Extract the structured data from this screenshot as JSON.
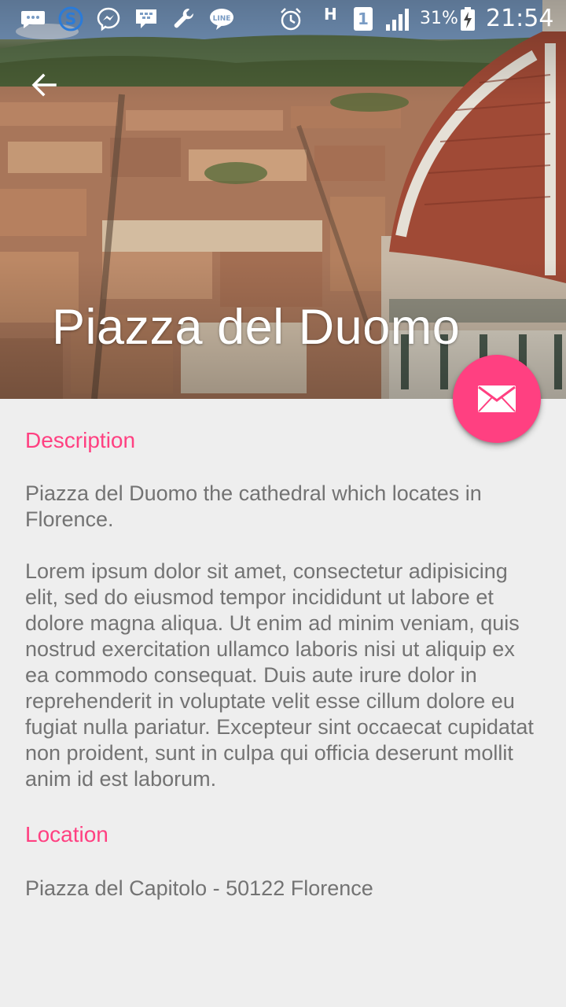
{
  "status_bar": {
    "battery": "31%",
    "time": "21:54",
    "network": "H",
    "sim": "1",
    "icons": [
      "message-icon",
      "skype-icon",
      "messenger-icon",
      "bbm-icon",
      "wrench-icon",
      "line-icon",
      "alarm-icon",
      "signal-icon",
      "battery-charging-icon"
    ]
  },
  "header": {
    "title": "Piazza del Duomo",
    "back_icon": "arrow-back-icon"
  },
  "fab": {
    "icon": "mail-icon"
  },
  "colors": {
    "accent": "#ff4081",
    "text": "#737373",
    "background": "#eeeeee"
  },
  "description": {
    "heading": "Description",
    "summary": "Piazza del Duomo the cathedral which locates in Florence.",
    "body": "Lorem ipsum dolor sit amet, consectetur adipisicing elit, sed do eiusmod tempor incididunt ut labore et dolore magna aliqua. Ut enim ad minim veniam, quis nostrud exercitation ullamco laboris nisi ut aliquip ex ea commodo consequat. Duis aute irure dolor in reprehenderit in voluptate velit esse cillum dolore eu fugiat nulla pariatur. Excepteur sint occaecat cupidatat non proident, sunt in culpa qui officia deserunt mollit anim id est laborum."
  },
  "location": {
    "heading": "Location",
    "address": "Piazza del Capitolo - 50122 Florence"
  }
}
